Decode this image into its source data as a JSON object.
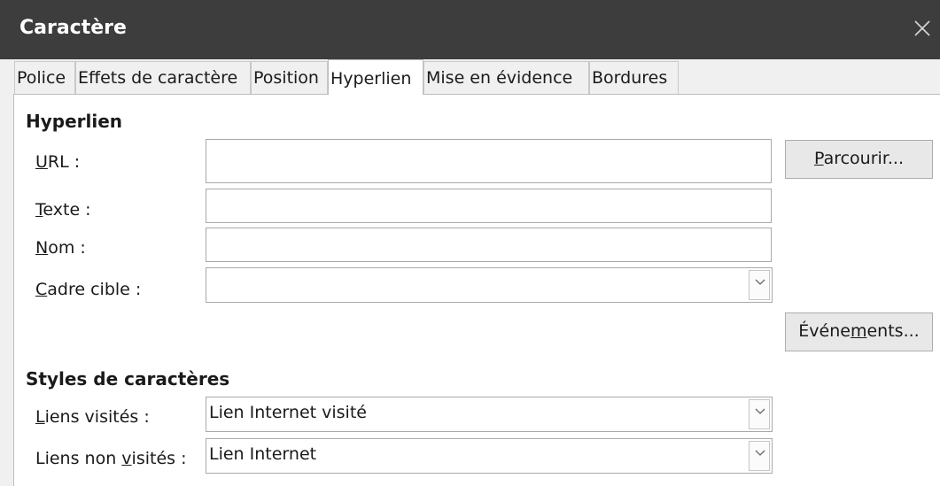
{
  "window": {
    "title": "Caractère",
    "close_icon": "close-icon"
  },
  "tabs": [
    {
      "label": "Police",
      "active": false
    },
    {
      "label": "Effets de caractère",
      "active": false
    },
    {
      "label": "Position",
      "active": false
    },
    {
      "label": "Hyperlien",
      "active": true
    },
    {
      "label": "Mise en évidence",
      "active": false
    },
    {
      "label": "Bordures",
      "active": false
    }
  ],
  "hyperlink": {
    "section_title": "Hyperlien",
    "url": {
      "mnemonic": "U",
      "rest": "RL :",
      "value": ""
    },
    "text": {
      "mnemonic": "T",
      "rest": "exte :",
      "value": ""
    },
    "name": {
      "mnemonic": "N",
      "rest": "om :",
      "value": ""
    },
    "target_frame": {
      "mnemonic": "C",
      "rest": "adre cible :",
      "value": ""
    },
    "browse_button": {
      "mnemonic": "P",
      "rest": "arcourir..."
    },
    "events_button": {
      "pre": "Événe",
      "mnemonic": "m",
      "rest": "ents..."
    }
  },
  "char_styles": {
    "section_title": "Styles de caractères",
    "visited": {
      "mnemonic": "L",
      "rest": "iens visités :",
      "value": "Lien Internet visité"
    },
    "unvisited": {
      "pre": "Liens non ",
      "mnemonic": "v",
      "rest": "isités :",
      "value": "Lien Internet"
    }
  },
  "colors": {
    "titlebar": "#3d3d3d",
    "panel": "#ffffff",
    "border": "#a9a9a9"
  }
}
